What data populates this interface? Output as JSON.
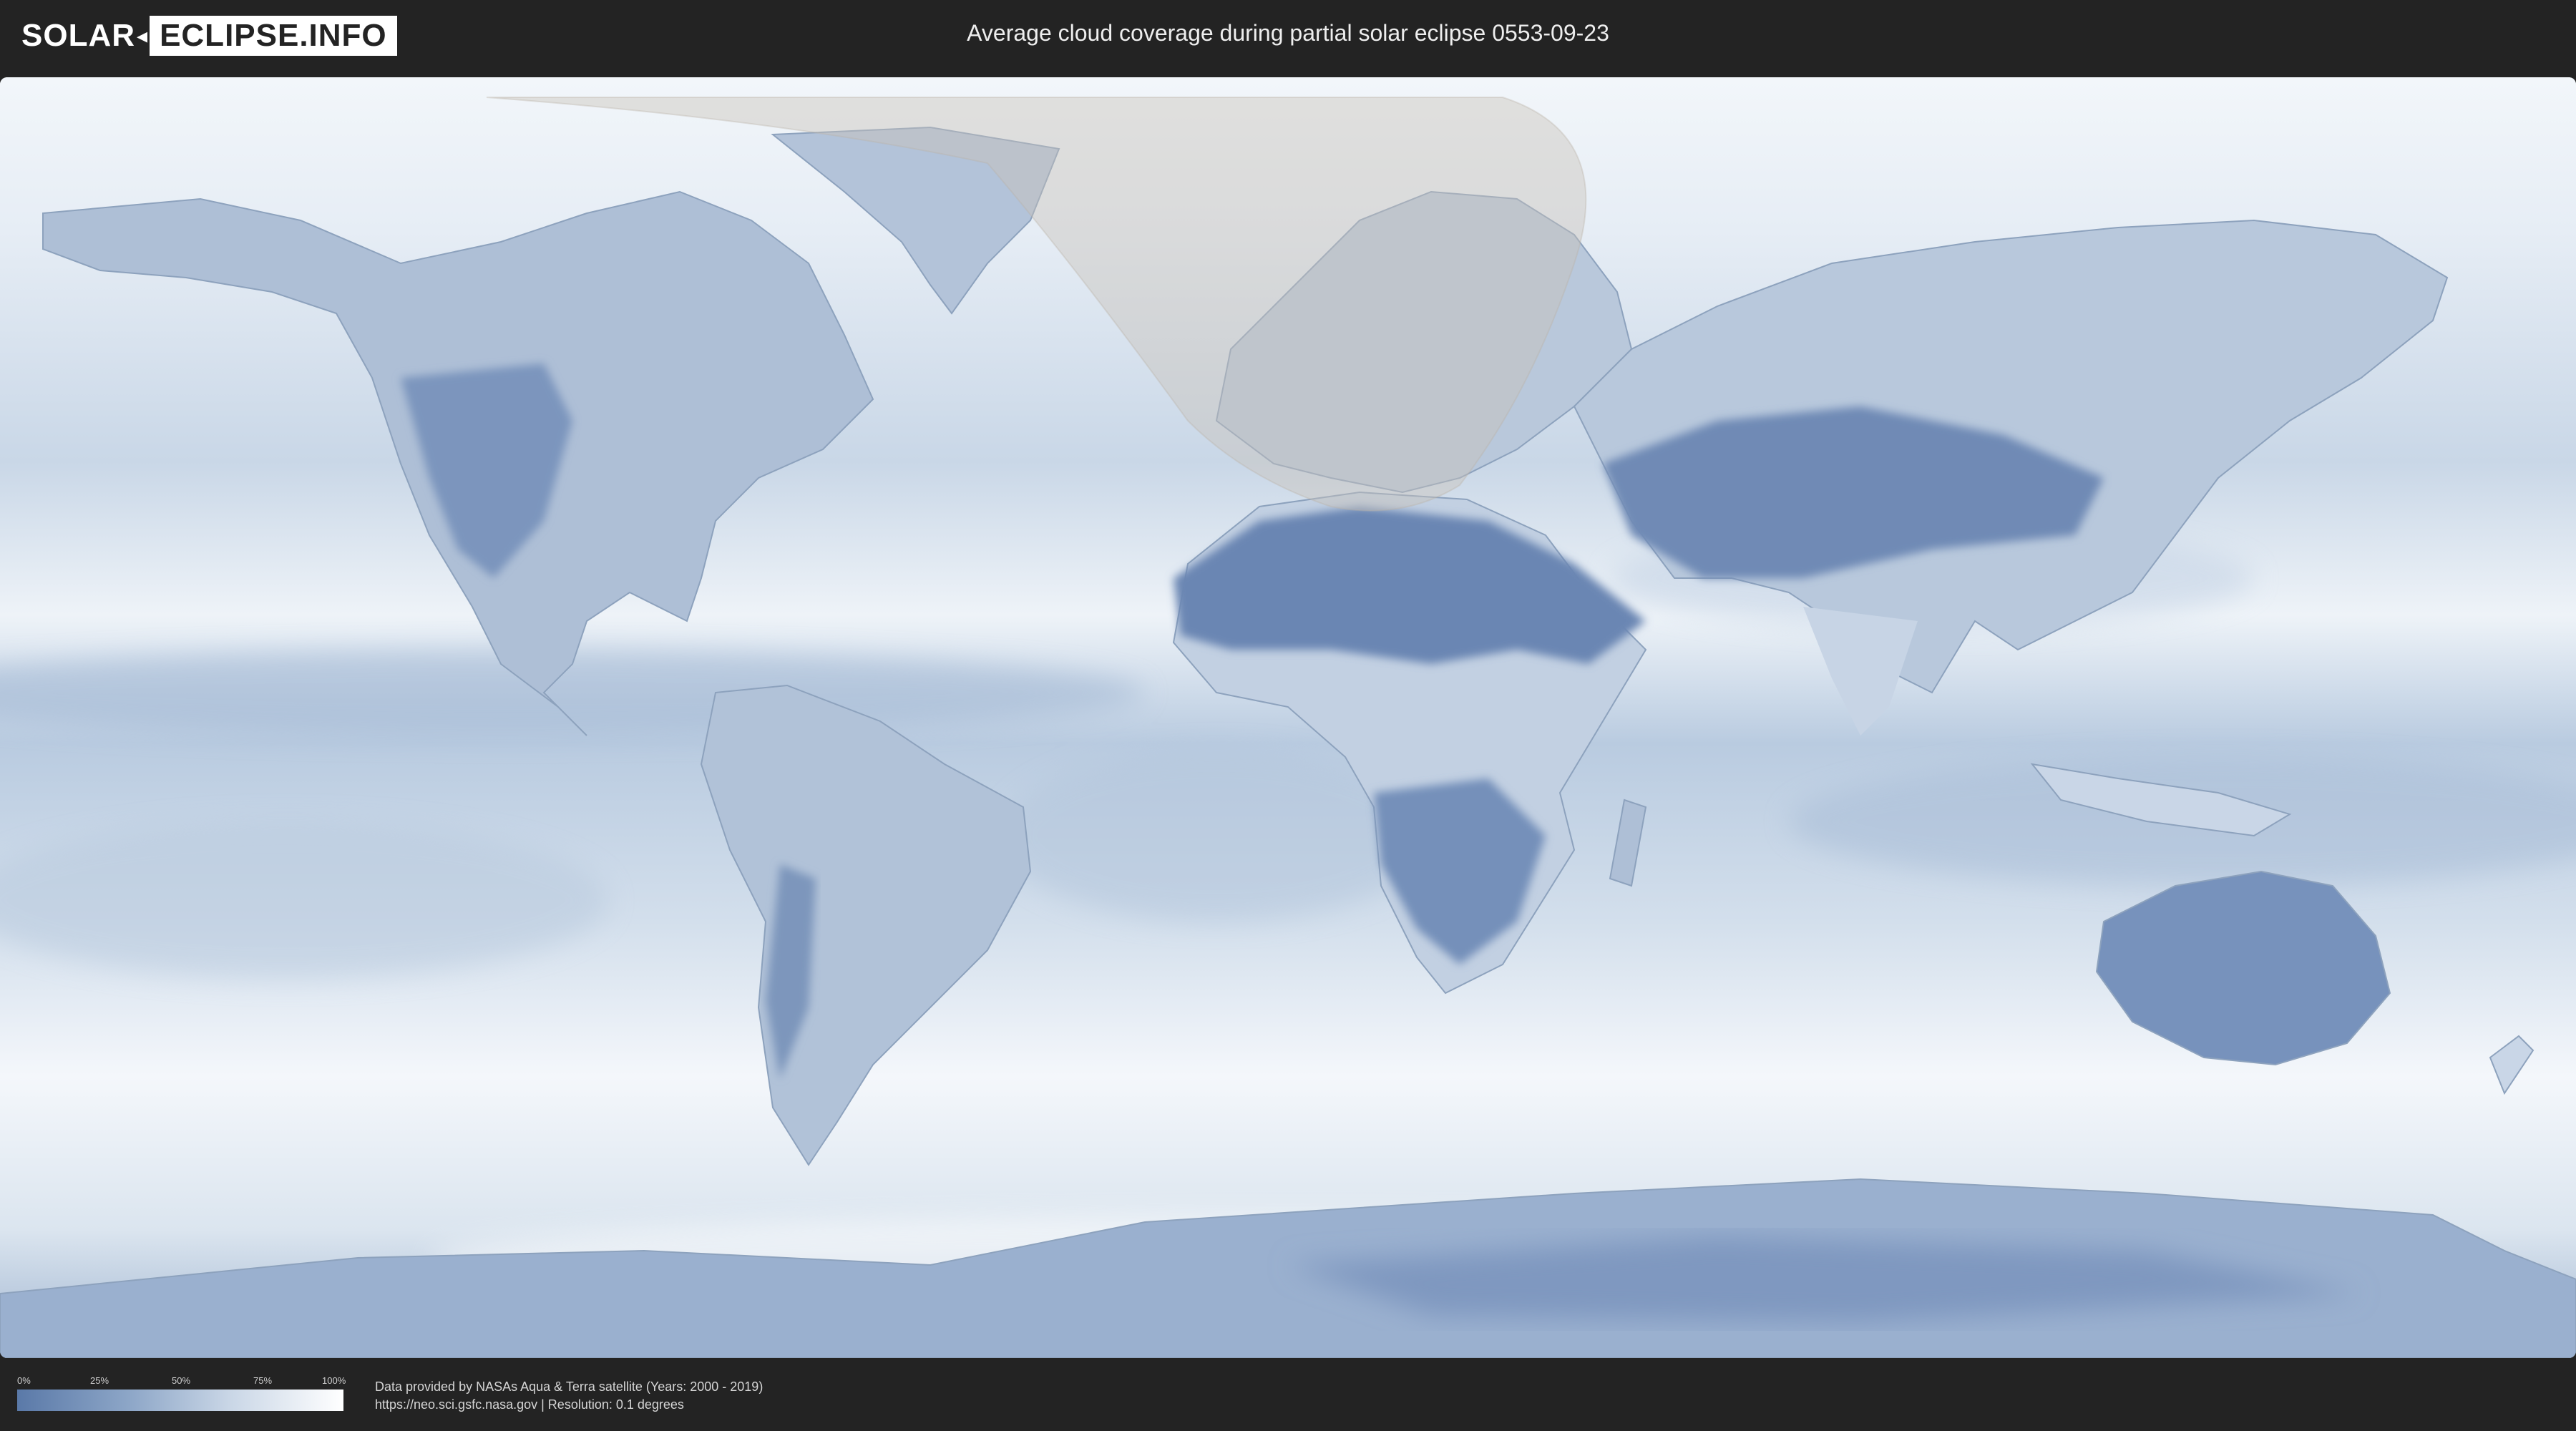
{
  "header": {
    "logo_part1": "SOLAR",
    "logo_part2": "ECLIPSE.INFO",
    "title": "Average cloud coverage during partial solar eclipse 0553-09-23"
  },
  "legend": {
    "ticks": [
      "0%",
      "25%",
      "50%",
      "75%",
      "100%"
    ],
    "colors": {
      "low": "#5a79a8",
      "high": "#ffffff"
    }
  },
  "credits": {
    "line1": "Data provided by NASAs Aqua & Terra satellite (Years: 2000 - 2019)",
    "line2": "https://neo.sci.gsfc.nasa.gov | Resolution: 0.1 degrees"
  },
  "map": {
    "colors": {
      "ocean_clouds": "#eef3f8",
      "dry_land": "#6d88b4",
      "eclipse_zone": "#c9c2b8"
    }
  }
}
